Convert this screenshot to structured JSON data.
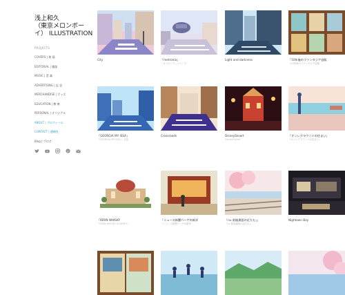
{
  "site": {
    "title_line1": "浅上和久",
    "title_line2": "（東京メロンボー",
    "title_line3": "イ） ILLUSTRATION"
  },
  "nav": {
    "heading": "PROJECTS",
    "items": [
      {
        "label": "COVERS | 装 画"
      },
      {
        "label": "EDITORIAL | 雑誌"
      },
      {
        "label": "MUSIC | 音 楽"
      },
      {
        "label": "ADVERTISING | 広 告"
      },
      {
        "label": "MERCHANDISE | グッズ"
      },
      {
        "label": "EDUCATION | 教 育"
      },
      {
        "label": "PERSONAL | オリジナル"
      },
      {
        "label": "ABOUT | プロフィール",
        "active": true
      },
      {
        "label": "CONTACT | 連絡先",
        "active": true
      },
      {
        "label": "Blog | ブログ"
      }
    ],
    "socials": [
      "twitter-icon",
      "youtube-icon",
      "instagram-icon",
      "pinterest-icon",
      "mail-icon"
    ]
  },
  "gallery": [
    {
      "title": "City",
      "subtitle": ""
    },
    {
      "title": "「metronia」",
      "subtitle": "「メトロニア」シリーズ"
    },
    {
      "title": "Light and darkness",
      "subtitle": ""
    },
    {
      "title": "「10年後のファンタジア自販",
      "subtitle": "「10年後のファンタジア自販"
    },
    {
      "title": "「GEORGIA MY ISSA」",
      "subtitle": "「GEORGIA MY ISSA」 広告"
    },
    {
      "title": "Crossroads",
      "subtitle": ""
    },
    {
      "title": "DisneySesert",
      "subtitle": "DisneySesert"
    },
    {
      "title": "「オンレグラウンドの住まい」",
      "subtitle": "「オンレグラウンドの住まい」"
    },
    {
      "title": "「KIRIN WHISKY",
      "subtitle": "「KIRIN WHISKY JOURNEY」"
    },
    {
      "title": "「ニュース新聞バーゲの新学",
      "subtitle": "「ニュース新聞バーゲの新学"
    },
    {
      "title": "「nu 前後建設の近たも」」",
      "subtitle": "「nu 前後建設の近たも」"
    },
    {
      "title": "Nightown Boy",
      "subtitle": ""
    },
    {
      "title": "",
      "subtitle": ""
    },
    {
      "title": "",
      "subtitle": ""
    },
    {
      "title": "",
      "subtitle": ""
    },
    {
      "title": "",
      "subtitle": ""
    }
  ],
  "colors": {
    "accent": "#3aa0c8",
    "text": "#333333",
    "muted": "#999999"
  }
}
